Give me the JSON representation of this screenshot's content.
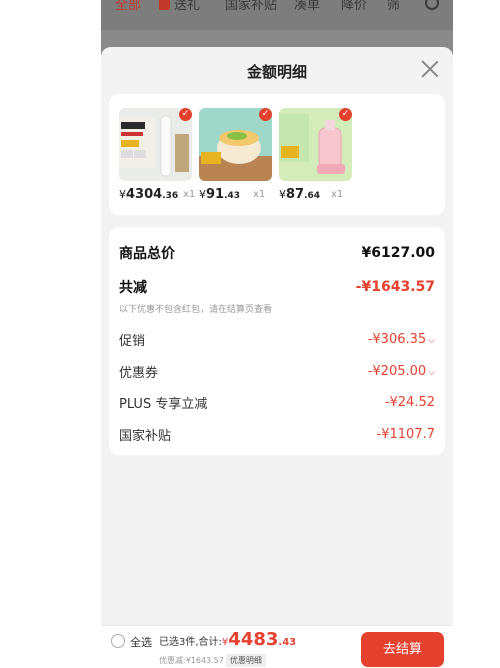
{
  "topnav": {
    "items": [
      "全部",
      "送礼",
      "国家补贴",
      "凑单",
      "降价",
      "筛"
    ]
  },
  "sheet": {
    "title": "金额明细"
  },
  "products": [
    {
      "price_int": "4304",
      "price_dec": ".36",
      "qty": "x1",
      "currency": "¥"
    },
    {
      "price_int": "91",
      "price_dec": ".43",
      "qty": "x1",
      "currency": "¥"
    },
    {
      "price_int": "87",
      "price_dec": ".64",
      "qty": "x1",
      "currency": "¥"
    }
  ],
  "summary": {
    "total_label": "商品总价",
    "total_value": "¥6127.00",
    "reduce_label": "共减",
    "reduce_value": "-¥1643.57",
    "note": "以下优惠不包含红包，请在结算页查看",
    "items": [
      {
        "label": "促销",
        "value": "-¥306.35"
      },
      {
        "label": "优惠券",
        "value": "-¥205.00"
      },
      {
        "label": "PLUS 专享立减",
        "value": "-¥24.52"
      },
      {
        "label": "国家补贴",
        "value": "-¥1107.7"
      }
    ]
  },
  "bottombar": {
    "select_all": "全选",
    "selected_prefix": "已选3件,合计:",
    "currency": "¥",
    "total_int": "4483",
    "total_dec": ".43",
    "discount_text": "优惠减:¥1643.57",
    "discount_chip": "优惠明细",
    "checkout": "去结算"
  },
  "colors": {
    "accent": "#e5412f",
    "overlay": "#7d7d7d",
    "sheet_bg": "#f3f3f3"
  }
}
